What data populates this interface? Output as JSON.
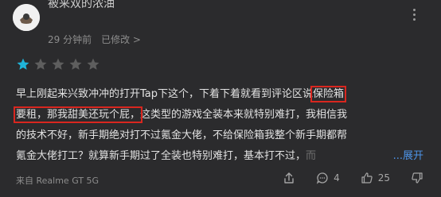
{
  "review": {
    "username": "被来双的浓油",
    "time_ago": "29 分钟前",
    "edited_label": "已修改 >",
    "rating": 1,
    "rating_max": 5,
    "colors": {
      "star_active": "#1fb4d9",
      "star_inactive": "#5e5e5e",
      "highlight_box": "#d9261f",
      "link": "#4d94e8"
    },
    "text_lines": [
      "早上刚起来兴致冲冲的打开Tap下这个，下着下着就看到评论区说",
      "保险箱",
      "要租，那我甜美还玩个屁，",
      "这类型的游戏全装本来就特别难打，我相信我",
      "的技术不好，新手期绝对打不过氪金大佬，不给保险箱我整个新手期都帮",
      "氪金大佬打工？就算新手期过了全装也特别难打，基本打不过，",
      "而"
    ],
    "expand_label": "...展开",
    "device": "来自 Realme GT 5G",
    "comment_count": "4",
    "like_count": "25"
  }
}
